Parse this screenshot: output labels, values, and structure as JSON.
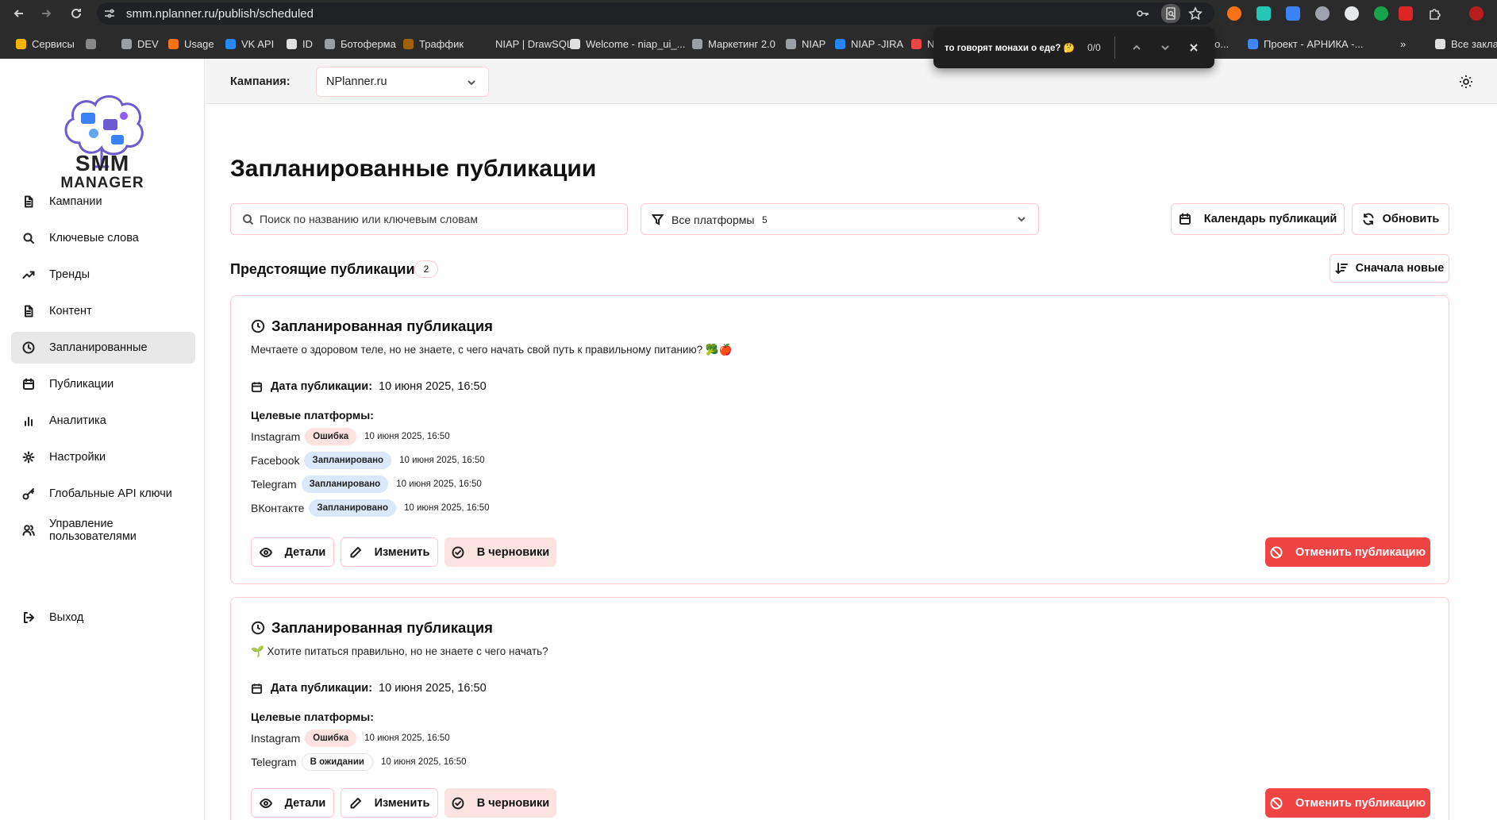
{
  "browser": {
    "url": "smm.nplanner.ru/publish/scheduled",
    "bookmarks": [
      {
        "label": "Сервисы",
        "color": "#f4b400"
      },
      {
        "label": "",
        "color": "#888888"
      },
      {
        "label": "DEV",
        "color": "#9aa0a6"
      },
      {
        "label": "Usage",
        "color": "#f97316"
      },
      {
        "label": "VK API",
        "color": "#2787f5"
      },
      {
        "label": "ID",
        "color": "#e0e0e0"
      },
      {
        "label": "Ботоферма",
        "color": "#9aa0a6"
      },
      {
        "label": "Траффик",
        "color": "#a16207"
      },
      {
        "label": "NIAP | DrawSQL",
        "color": "#2b2b2b"
      },
      {
        "label": "Welcome - niap_ui_...",
        "color": "#e0e0e0"
      },
      {
        "label": "Маркетинг 2.0",
        "color": "#9aa0a6"
      },
      {
        "label": "NIAP",
        "color": "#9aa0a6"
      },
      {
        "label": "NIAP -JIRA",
        "color": "#2684ff"
      },
      {
        "label": "N",
        "color": "#ef4444"
      },
      {
        "label": "Go...",
        "color": "#9aa0a6"
      },
      {
        "label": "Проект - АРНИКА -...",
        "color": "#4285f4"
      },
      {
        "label": "Все закладки",
        "color": "#e0e0e0"
      }
    ],
    "find": {
      "query": "то говорят монахи о еде? 🤔",
      "count": "0/0"
    }
  },
  "sidebar": {
    "logo_line1": "SMM",
    "logo_line2": "MANAGER",
    "items": [
      {
        "label": "Кампании",
        "icon": "file-icon"
      },
      {
        "label": "Ключевые слова",
        "icon": "search-icon"
      },
      {
        "label": "Тренды",
        "icon": "trending-icon"
      },
      {
        "label": "Контент",
        "icon": "file-icon"
      },
      {
        "label": "Запланированные",
        "icon": "clock-icon"
      },
      {
        "label": "Публикации",
        "icon": "calendar-icon"
      },
      {
        "label": "Аналитика",
        "icon": "bar-chart-icon"
      },
      {
        "label": "Настройки",
        "icon": "gear-icon"
      },
      {
        "label": "Глобальные API ключи",
        "icon": "key-icon"
      },
      {
        "label": "Управление пользователями",
        "icon": "users-icon"
      }
    ],
    "logout": "Выход"
  },
  "topbar": {
    "campaign_label": "Кампания:",
    "campaign_value": "NPlanner.ru"
  },
  "main": {
    "title": "Запланированные публикации",
    "search_placeholder": "Поиск по названию или ключевым словам",
    "platform_filter": "Все платформы",
    "platform_count": "5",
    "calendar_button": "Календарь публикаций",
    "refresh_button": "Обновить",
    "upcoming_title": "Предстоящие публикации",
    "upcoming_count": "2",
    "sort_button": "Сначала новые"
  },
  "cards": [
    {
      "title": "Запланированная публикация",
      "text": "Мечтаете о здоровом теле, но не знаете, с чего начать свой путь к правильному питанию? 🥦🍎",
      "date_label": "Дата публикации:",
      "date_value": "10 июня 2025, 16:50",
      "targets_label": "Целевые платформы:",
      "platforms": [
        {
          "name": "Instagram",
          "status": "Ошибка",
          "kind": "error",
          "time": "10 июня 2025, 16:50"
        },
        {
          "name": "Facebook",
          "status": "Запланировано",
          "kind": "scheduled",
          "time": "10 июня 2025, 16:50"
        },
        {
          "name": "Telegram",
          "status": "Запланировано",
          "kind": "scheduled",
          "time": "10 июня 2025, 16:50"
        },
        {
          "name": "ВКонтакте",
          "status": "Запланировано",
          "kind": "scheduled",
          "time": "10 июня 2025, 16:50"
        }
      ],
      "details": "Детали",
      "edit": "Изменить",
      "draft": "В черновики",
      "cancel": "Отменить публикацию"
    },
    {
      "title": "Запланированная публикация",
      "text": "🌱 Хотите питаться правильно, но не знаете с чего начать?",
      "date_label": "Дата публикации:",
      "date_value": "10 июня 2025, 16:50",
      "targets_label": "Целевые платформы:",
      "platforms": [
        {
          "name": "Instagram",
          "status": "Ошибка",
          "kind": "error",
          "time": "10 июня 2025, 16:50"
        },
        {
          "name": "Telegram",
          "status": "В ожидании",
          "kind": "pending",
          "time": "10 июня 2025, 16:50"
        }
      ],
      "details": "Детали",
      "edit": "Изменить",
      "draft": "В черновики",
      "cancel": "Отменить публикацию"
    }
  ],
  "colors": {
    "accent_border": "#ffc8cf",
    "danger": "#ef4444",
    "error_badge": "#fde2e2",
    "scheduled_badge": "#dbe7fb",
    "logo": "#6d5bd0"
  }
}
